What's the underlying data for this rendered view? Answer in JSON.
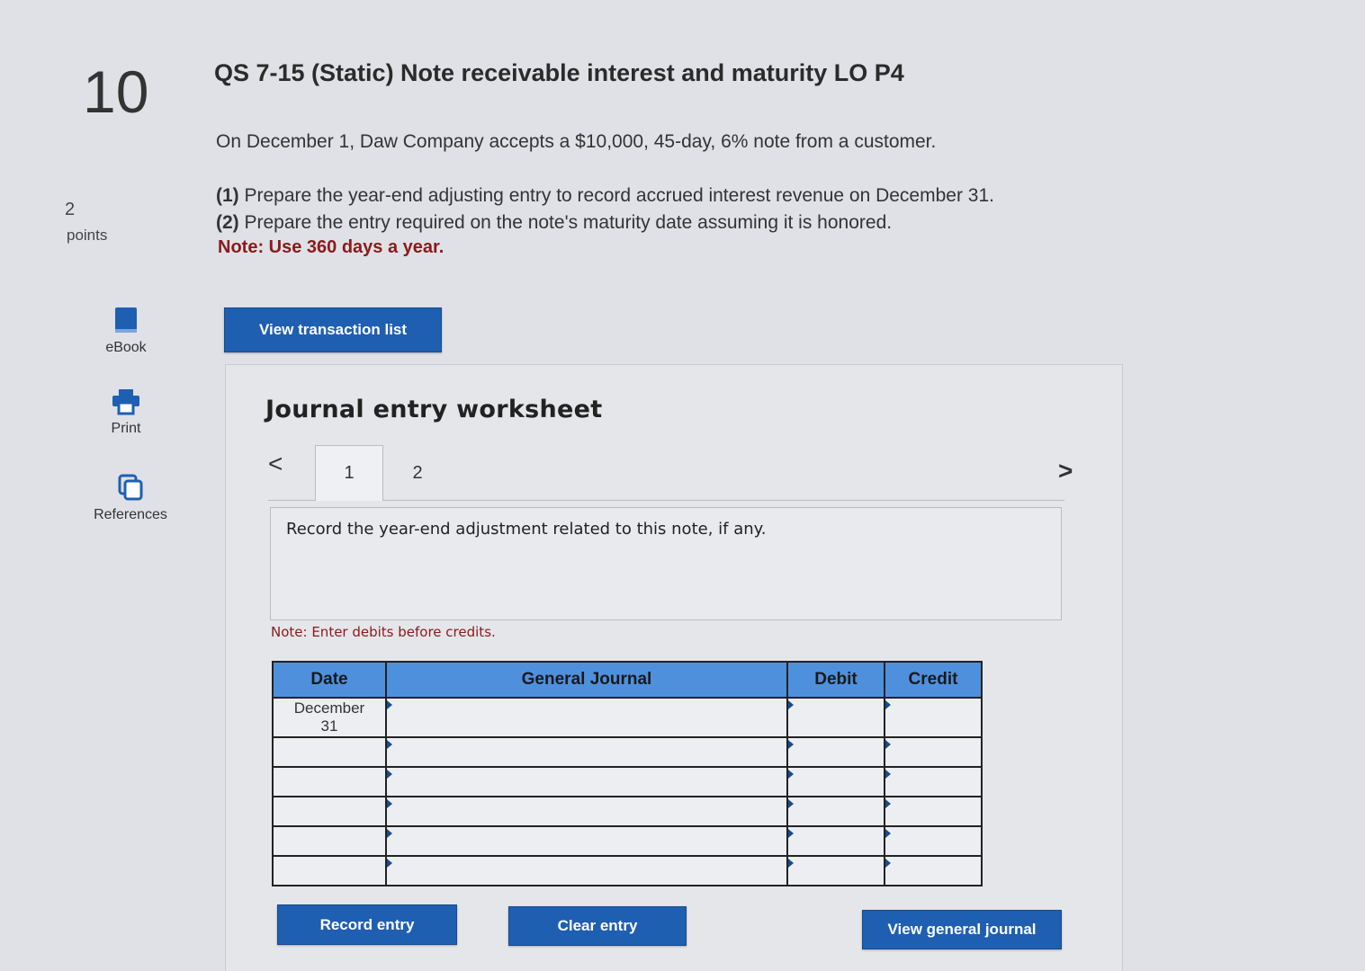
{
  "question": {
    "number": "10",
    "points_value": "2",
    "points_label": "points",
    "title": "QS 7-15 (Static) Note receivable interest and maturity LO P4",
    "prompt": "On December 1, Daw Company accepts a $10,000, 45-day, 6% note from a customer.",
    "requirements": [
      {
        "tag": "(1)",
        "text": " Prepare the year-end adjusting entry to record accrued interest revenue on December 31."
      },
      {
        "tag": "(2)",
        "text": " Prepare the entry required on the note's maturity date assuming it is honored."
      }
    ],
    "note": "Note: Use 360 days a year."
  },
  "tools": {
    "ebook": "eBook",
    "print": "Print",
    "references": "References"
  },
  "buttons": {
    "view_transaction_list": "View transaction list",
    "record_entry": "Record entry",
    "clear_entry": "Clear entry",
    "view_general_journal": "View general journal"
  },
  "worksheet": {
    "title": "Journal entry worksheet",
    "tabs": [
      "1",
      "2"
    ],
    "prev": "<",
    "next": ">",
    "instruction": "Record the year-end adjustment related to this note, if any.",
    "note": "Note: Enter debits before credits."
  },
  "journal": {
    "headers": {
      "date": "Date",
      "general_journal": "General Journal",
      "debit": "Debit",
      "credit": "Credit"
    },
    "date_first_line": "December",
    "date_second_line": "31"
  },
  "colors": {
    "button_blue": "#1f5fb2",
    "header_blue": "#4f90dd",
    "note_red": "#8b1a1a"
  }
}
